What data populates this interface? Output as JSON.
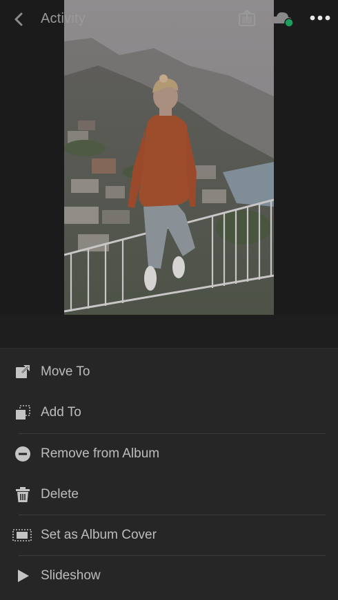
{
  "header": {
    "title": "Activity",
    "icons": {
      "back": "chevron-left-icon",
      "share": "share-export-icon",
      "cloud": "cloud-sync-icon",
      "more": "more-dots-icon"
    },
    "cloud_status_color": "#1e9e5c"
  },
  "photo": {
    "subject": "woman in orange sweater sitting on railing above coastal town"
  },
  "menu": {
    "items": [
      {
        "label": "Move To",
        "icon": "move-to-icon"
      },
      {
        "label": "Add To",
        "icon": "add-to-icon"
      },
      {
        "label": "Remove from Album",
        "icon": "remove-circle-icon"
      },
      {
        "label": "Delete",
        "icon": "trash-icon"
      },
      {
        "label": "Set as Album Cover",
        "icon": "album-cover-icon"
      },
      {
        "label": "Slideshow",
        "icon": "play-icon"
      }
    ]
  },
  "colors": {
    "background": "#1c1c1c",
    "sheet": "#262626",
    "text": "#bdbdbd",
    "icon": "#c4c4c4"
  }
}
